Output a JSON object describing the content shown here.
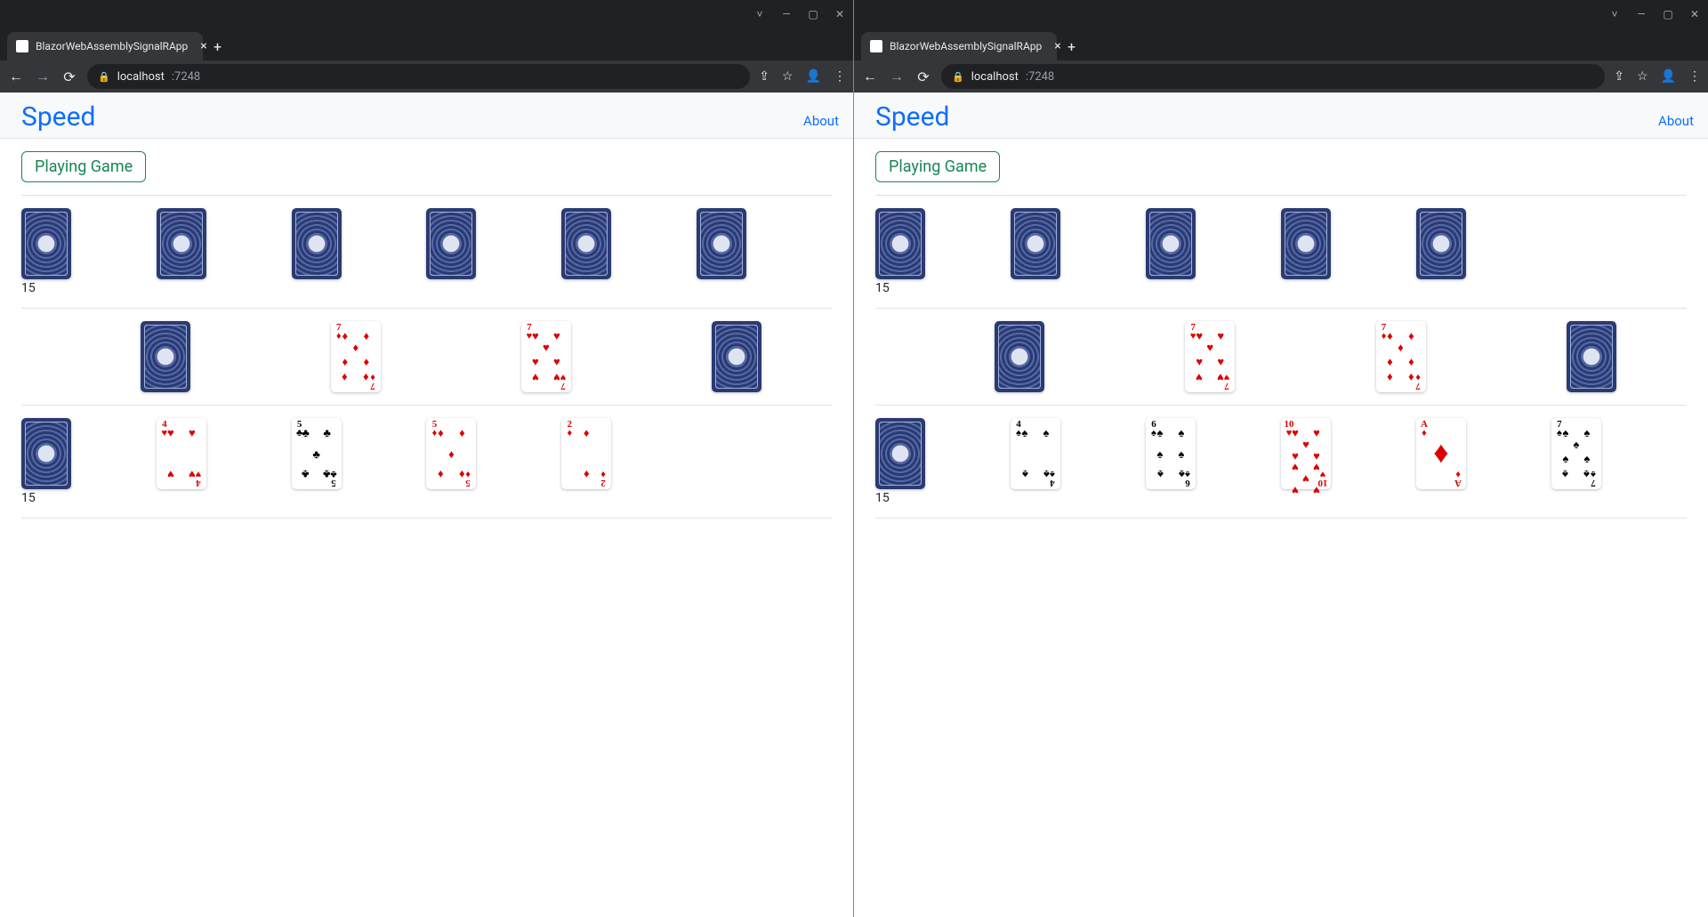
{
  "tab_title": "BlazorWebAssemblySignalRApp",
  "url_host": "localhost",
  "url_port": ":7248",
  "brand": "Speed",
  "about": "About",
  "status": "Playing Game",
  "suits": {
    "hearts": "♥",
    "diamonds": "♦",
    "clubs": "♣",
    "spades": "♠"
  },
  "left": {
    "opp_backs": 6,
    "opp_count": "15",
    "middle": [
      {
        "back": true
      },
      {
        "rank": "7",
        "suit": "diamonds",
        "color": "red"
      },
      {
        "rank": "7",
        "suit": "hearts",
        "color": "red"
      },
      {
        "back": true
      }
    ],
    "draw_count": "15",
    "hand": [
      {
        "back": true
      },
      {
        "rank": "4",
        "suit": "hearts",
        "color": "red"
      },
      {
        "rank": "5",
        "suit": "clubs",
        "color": "blk"
      },
      {
        "rank": "5",
        "suit": "diamonds",
        "color": "red"
      },
      {
        "rank": "2",
        "suit": "diamonds",
        "color": "red"
      }
    ]
  },
  "right": {
    "opp_backs": 5,
    "opp_count": "15",
    "middle": [
      {
        "back": true
      },
      {
        "rank": "7",
        "suit": "hearts",
        "color": "red"
      },
      {
        "rank": "7",
        "suit": "diamonds",
        "color": "red"
      },
      {
        "back": true
      }
    ],
    "draw_count": "15",
    "hand": [
      {
        "back": true
      },
      {
        "rank": "4",
        "suit": "spades",
        "color": "blk"
      },
      {
        "rank": "6",
        "suit": "spades",
        "color": "blk"
      },
      {
        "rank": "10",
        "suit": "hearts",
        "color": "red"
      },
      {
        "rank": "A",
        "suit": "diamonds",
        "color": "red"
      },
      {
        "rank": "7",
        "suit": "spades",
        "color": "blk"
      }
    ]
  }
}
